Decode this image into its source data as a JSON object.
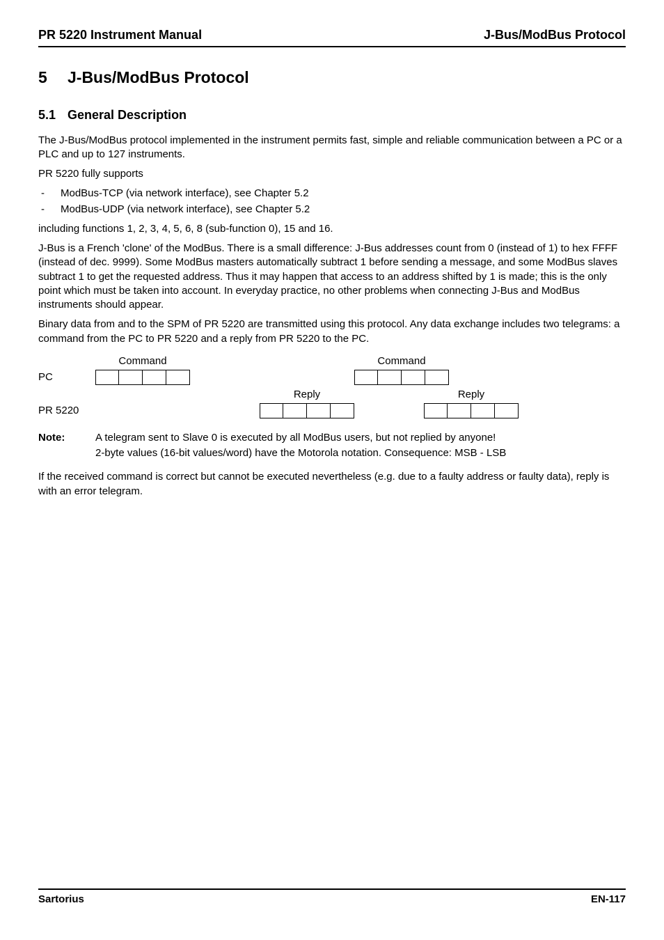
{
  "header": {
    "left": "PR 5220 Instrument Manual",
    "right": "J-Bus/ModBus Protocol"
  },
  "chapter": {
    "number": "5",
    "title": "J-Bus/ModBus Protocol"
  },
  "section": {
    "number": "5.1",
    "title": "General Description"
  },
  "body": {
    "p1": "The J-Bus/ModBus protocol implemented in the instrument permits fast, simple and reliable communication between a PC or a PLC and up to 127 instruments.",
    "p2": "PR 5220 fully supports",
    "li1": "ModBus-TCP (via network interface), see Chapter 5.2",
    "li2": "ModBus-UDP (via network interface), see Chapter 5.2",
    "p3": "including functions 1, 2, 3, 4, 5, 6, 8 (sub-function 0), 15 and 16.",
    "p4": "J-Bus is a French 'clone' of the ModBus. There is a small difference: J-Bus addresses count from 0 (instead of 1) to hex FFFF (instead of dec. 9999). Some ModBus masters automatically subtract 1 before sending a message, and some ModBus slaves subtract 1 to get the requested address. Thus it may happen that access to an address shifted by 1 is made; this is the only point which must be taken into account. In everyday practice, no other problems when connecting J-Bus and ModBus instruments should appear.",
    "p5": "Binary data from and to the SPM of PR 5220 are transmitted using this protocol. Any data exchange includes two telegrams: a command from the PC to PR 5220 and a reply from PR 5220 to the PC.",
    "p6": "If the received command is correct but cannot be executed nevertheless (e.g. due to a faulty address or faulty data), reply is with an error telegram."
  },
  "diagram": {
    "pc_label": "PC",
    "pr_label": "PR 5220",
    "command_label": "Command",
    "reply_label": "Reply"
  },
  "note": {
    "label": "Note:",
    "line1": "A telegram sent to Slave 0 is executed by all ModBus users, but not replied by anyone!",
    "line2": "2-byte values (16-bit values/word) have the Motorola notation. Consequence: MSB - LSB"
  },
  "footer": {
    "left": "Sartorius",
    "right": "EN-117"
  }
}
